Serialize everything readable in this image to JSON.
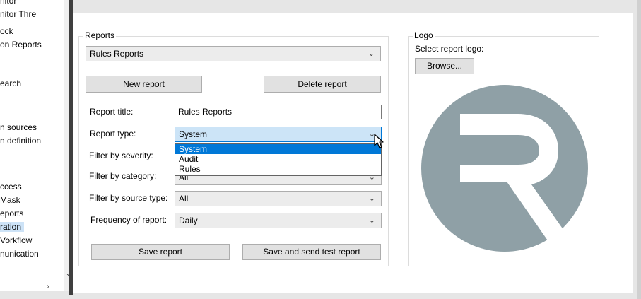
{
  "sidebar": {
    "items": [
      {
        "label": "nitor",
        "selected": false
      },
      {
        "label": "nitor Thre",
        "selected": false
      },
      {
        "label": "ock",
        "selected": false
      },
      {
        "label": "on Reports",
        "selected": false
      },
      {
        "label": "earch",
        "selected": false
      },
      {
        "label": "n sources",
        "selected": false
      },
      {
        "label": "n definition",
        "selected": false
      },
      {
        "label": "ccess",
        "selected": false
      },
      {
        "label": "Mask",
        "selected": false
      },
      {
        "label": "eports",
        "selected": false
      },
      {
        "label": "ration",
        "selected": true
      },
      {
        "label": "Vorkflow",
        "selected": false
      },
      {
        "label": "nunication",
        "selected": false
      }
    ],
    "scroll_down_glyph": "⌄",
    "scroll_right_glyph": "›"
  },
  "reports": {
    "legend": "Reports",
    "selected_report": "Rules Reports",
    "new_button": "New report",
    "delete_button": "Delete report"
  },
  "form": {
    "title_label": "Report title:",
    "title_value": "Rules Reports",
    "type_label": "Report type:",
    "type_value": "System",
    "type_options": [
      "System",
      "Audit",
      "Rules"
    ],
    "severity_label": "Filter by severity:",
    "category_label": "Filter by category:",
    "category_value": "All",
    "source_label": "Filter by source type:",
    "source_value": "All",
    "frequency_label": "Frequency of report:",
    "frequency_value": "Daily",
    "save_button": "Save report",
    "save_send_button": "Save and send test report"
  },
  "logo": {
    "legend": "Logo",
    "select_label": "Select report logo:",
    "browse_button": "Browse...",
    "circle_color": "#8fa0a6"
  },
  "icons": {
    "chevron": "⌄"
  }
}
